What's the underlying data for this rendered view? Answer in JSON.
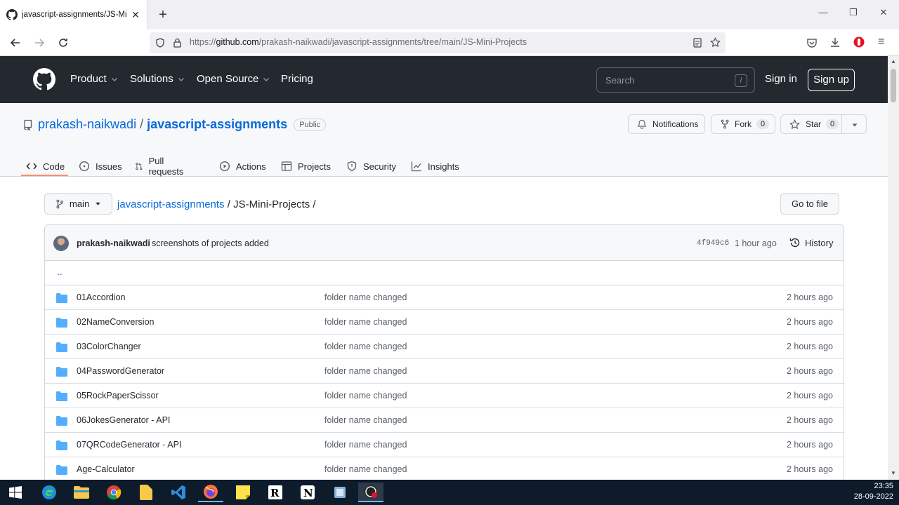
{
  "browser": {
    "tab_title": "javascript-assignments/JS-Mini-Projects",
    "tab_close": "✕",
    "new_tab": "+",
    "url_prefix": "https://",
    "url_host": "github.com",
    "url_path": "/prakash-naikwadi/javascript-assignments/tree/main/JS-Mini-Projects"
  },
  "gh_header": {
    "nav": [
      {
        "label": "Product"
      },
      {
        "label": "Solutions"
      },
      {
        "label": "Open Source"
      },
      {
        "label": "Pricing"
      }
    ],
    "search_placeholder": "Search",
    "search_shortcut": "/",
    "sign_in": "Sign in",
    "sign_up": "Sign up"
  },
  "repo": {
    "owner": "prakash-naikwadi",
    "separator": "/",
    "name": "javascript-assignments",
    "visibility": "Public",
    "notifications": "Notifications",
    "fork_label": "Fork",
    "fork_count": "0",
    "star_label": "Star",
    "star_count": "0",
    "tabs": [
      {
        "label": "Code",
        "icon": "code-icon"
      },
      {
        "label": "Issues",
        "icon": "issue-icon"
      },
      {
        "label": "Pull requests",
        "icon": "pull-request-icon"
      },
      {
        "label": "Actions",
        "icon": "play-icon"
      },
      {
        "label": "Projects",
        "icon": "table-icon"
      },
      {
        "label": "Security",
        "icon": "shield-icon"
      },
      {
        "label": "Insights",
        "icon": "graph-icon"
      }
    ]
  },
  "nav": {
    "branch": "main",
    "crumb_repo": "javascript-assignments",
    "crumb_sep1": " / ",
    "crumb_dir": "JS-Mini-Projects",
    "crumb_sep2": " /",
    "go_to_file": "Go to file"
  },
  "commit": {
    "author": "prakash-naikwadi",
    "message": "screenshots of projects added",
    "sha": "4f949c6",
    "ago": "1 hour ago",
    "history": "History"
  },
  "updir": "..",
  "files": [
    {
      "name": "01Accordion",
      "message": "folder name changed",
      "age": "2 hours ago"
    },
    {
      "name": "02NameConversion",
      "message": "folder name changed",
      "age": "2 hours ago"
    },
    {
      "name": "03ColorChanger",
      "message": "folder name changed",
      "age": "2 hours ago"
    },
    {
      "name": "04PasswordGenerator",
      "message": "folder name changed",
      "age": "2 hours ago"
    },
    {
      "name": "05RockPaperScissor",
      "message": "folder name changed",
      "age": "2 hours ago"
    },
    {
      "name": "06JokesGenerator - API",
      "message": "folder name changed",
      "age": "2 hours ago"
    },
    {
      "name": "07QRCodeGenerator - API",
      "message": "folder name changed",
      "age": "2 hours ago"
    },
    {
      "name": "Age-Calculator",
      "message": "folder name changed",
      "age": "2 hours ago"
    }
  ],
  "taskbar": {
    "time": "23:35",
    "date": "28-09-2022"
  },
  "colors": {
    "link": "#0969da",
    "header_bg": "#24292f",
    "folder": "#54aeff",
    "tab_underline": "#fd8c73"
  }
}
